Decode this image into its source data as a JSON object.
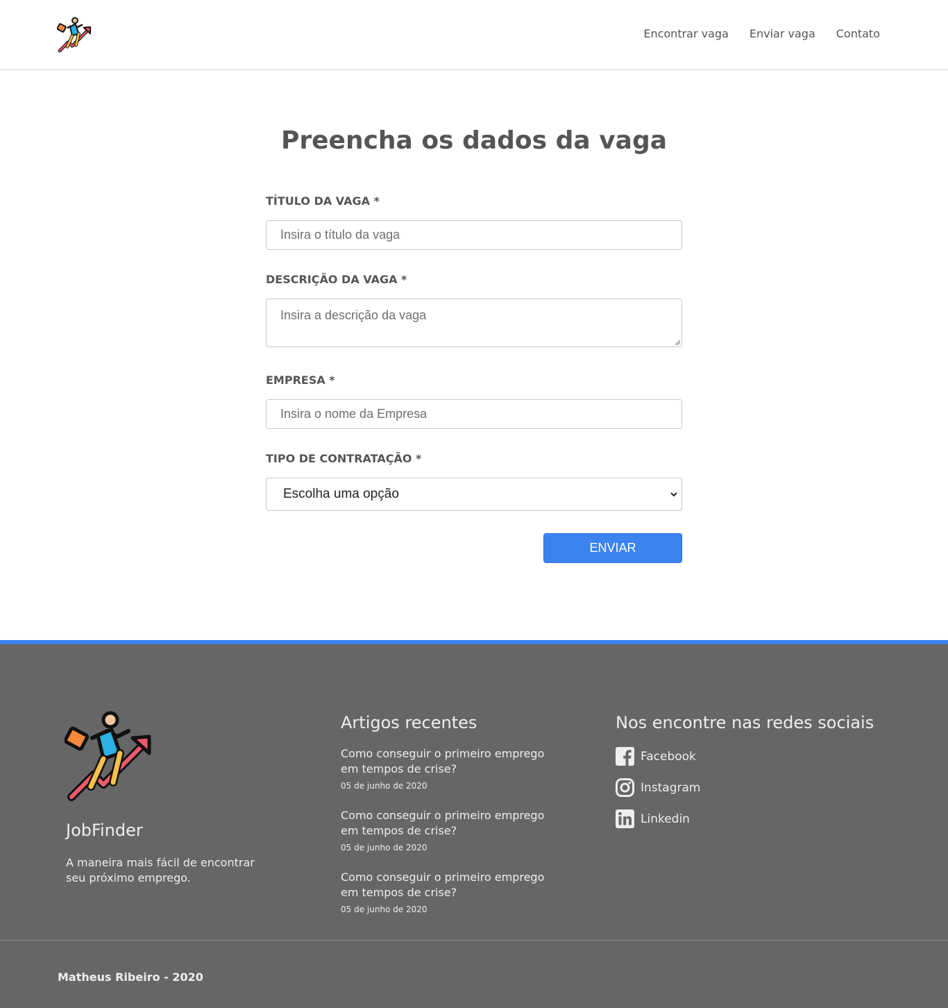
{
  "nav": {
    "items": [
      "Encontrar vaga",
      "Enviar vaga",
      "Contato"
    ]
  },
  "form": {
    "title": "Preencha os dados da vaga",
    "fields": [
      {
        "label": "TÍTULO DA VAGA *",
        "placeholder": "Insira o título da vaga"
      },
      {
        "label": "DESCRIÇÃO DA VAGA *",
        "placeholder": "Insira a descrição da vaga"
      },
      {
        "label": "EMPRESA *",
        "placeholder": "Insira o nome da Empresa"
      },
      {
        "label": "TIPO DE CONTRATAÇÃO *",
        "selected": "Escolha uma opção"
      }
    ],
    "submit_label": "ENVIAR"
  },
  "footer": {
    "brand": "JobFinder",
    "tagline": "A maneira mais fácil de encontrar seu próximo emprego.",
    "articles_title": "Artigos recentes",
    "articles": [
      {
        "title": "Como conseguir o primeiro emprego em tempos de crise?",
        "date": "05 de junho de 2020"
      },
      {
        "title": "Como conseguir o primeiro emprego em tempos de crise?",
        "date": "05 de junho de 2020"
      },
      {
        "title": "Como conseguir o primeiro emprego em tempos de crise?",
        "date": "05 de junho de 2020"
      }
    ],
    "social_title": "Nos encontre nas redes sociais",
    "social": [
      {
        "label": "Facebook",
        "icon": "facebook-icon"
      },
      {
        "label": "Instagram",
        "icon": "instagram-icon"
      },
      {
        "label": "Linkedin",
        "icon": "linkedin-icon"
      }
    ],
    "copyright": "Matheus Ribeiro - 2020"
  },
  "colors": {
    "accent": "#3d83f0",
    "footer_bg": "#666666",
    "text": "#555555"
  }
}
